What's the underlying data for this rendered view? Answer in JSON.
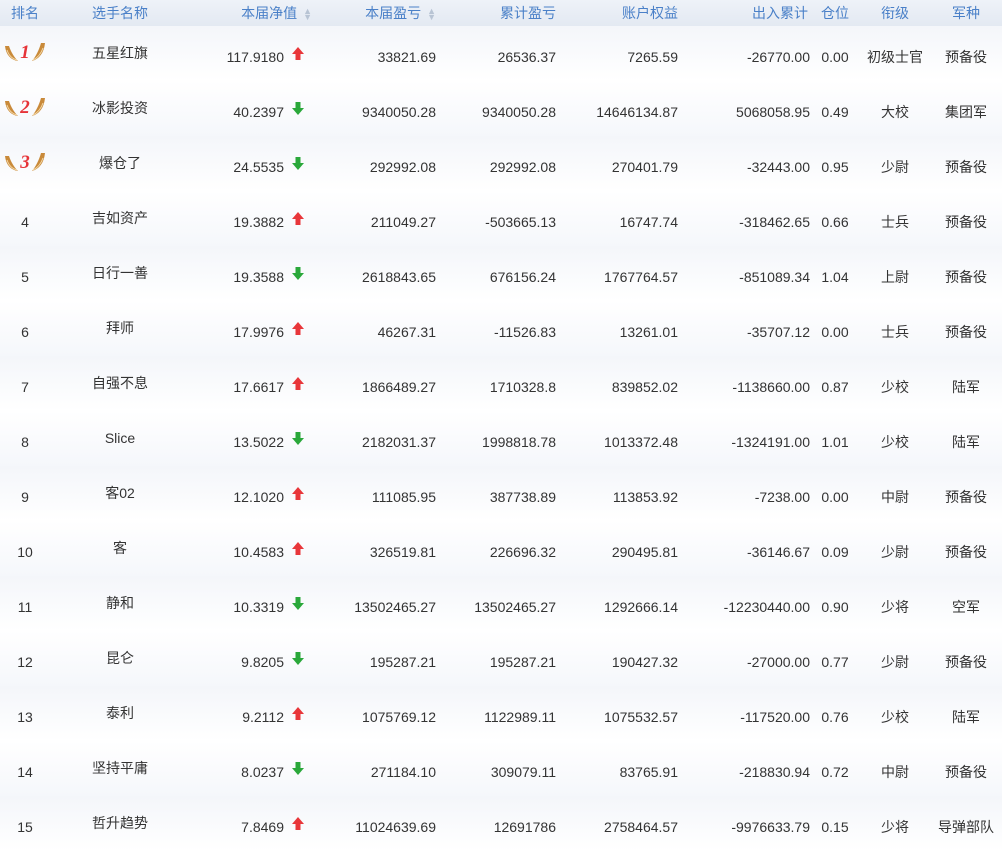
{
  "headers": [
    "排名",
    "选手名称",
    "本届净值",
    "本届盈亏",
    "累计盈亏",
    "账户权益",
    "出入累计",
    "仓位",
    "衔级",
    "军种"
  ],
  "colors": {
    "header_text": "#4a80c8",
    "up_arrow": "#e8363a",
    "down_arrow": "#2aa83a",
    "medal": "#c98a3a",
    "medal_number": "#e63338"
  },
  "rows": [
    {
      "rank": "1",
      "medal": true,
      "name": "五星红旗",
      "nav": "117.9180",
      "trend": "up",
      "period_pnl": "33821.69",
      "total_pnl": "26536.37",
      "equity": "7265.59",
      "flow": "-26770.00",
      "position": "0.00",
      "title": "初级士官",
      "branch": "预备役"
    },
    {
      "rank": "2",
      "medal": true,
      "name": "冰影投资",
      "nav": "40.2397",
      "trend": "down",
      "period_pnl": "9340050.28",
      "total_pnl": "9340050.28",
      "equity": "14646134.87",
      "flow": "5068058.95",
      "position": "0.49",
      "title": "大校",
      "branch": "集团军"
    },
    {
      "rank": "3",
      "medal": true,
      "name": "爆仓了",
      "nav": "24.5535",
      "trend": "down",
      "period_pnl": "292992.08",
      "total_pnl": "292992.08",
      "equity": "270401.79",
      "flow": "-32443.00",
      "position": "0.95",
      "title": "少尉",
      "branch": "预备役"
    },
    {
      "rank": "4",
      "medal": false,
      "name": "吉如资产",
      "nav": "19.3882",
      "trend": "up",
      "period_pnl": "211049.27",
      "total_pnl": "-503665.13",
      "equity": "16747.74",
      "flow": "-318462.65",
      "position": "0.66",
      "title": "士兵",
      "branch": "预备役"
    },
    {
      "rank": "5",
      "medal": false,
      "name": "日行一善",
      "nav": "19.3588",
      "trend": "down",
      "period_pnl": "2618843.65",
      "total_pnl": "676156.24",
      "equity": "1767764.57",
      "flow": "-851089.34",
      "position": "1.04",
      "title": "上尉",
      "branch": "预备役"
    },
    {
      "rank": "6",
      "medal": false,
      "name": "拜师",
      "nav": "17.9976",
      "trend": "up",
      "period_pnl": "46267.31",
      "total_pnl": "-11526.83",
      "equity": "13261.01",
      "flow": "-35707.12",
      "position": "0.00",
      "title": "士兵",
      "branch": "预备役"
    },
    {
      "rank": "7",
      "medal": false,
      "name": "自强不息",
      "nav": "17.6617",
      "trend": "up",
      "period_pnl": "1866489.27",
      "total_pnl": "1710328.8",
      "equity": "839852.02",
      "flow": "-1138660.00",
      "position": "0.87",
      "title": "少校",
      "branch": "陆军"
    },
    {
      "rank": "8",
      "medal": false,
      "name": "Slice",
      "nav": "13.5022",
      "trend": "down",
      "period_pnl": "2182031.37",
      "total_pnl": "1998818.78",
      "equity": "1013372.48",
      "flow": "-1324191.00",
      "position": "1.01",
      "title": "少校",
      "branch": "陆军"
    },
    {
      "rank": "9",
      "medal": false,
      "name": "客02",
      "nav": "12.1020",
      "trend": "up",
      "period_pnl": "111085.95",
      "total_pnl": "387738.89",
      "equity": "113853.92",
      "flow": "-7238.00",
      "position": "0.00",
      "title": "中尉",
      "branch": "预备役"
    },
    {
      "rank": "10",
      "medal": false,
      "name": "客",
      "nav": "10.4583",
      "trend": "up",
      "period_pnl": "326519.81",
      "total_pnl": "226696.32",
      "equity": "290495.81",
      "flow": "-36146.67",
      "position": "0.09",
      "title": "少尉",
      "branch": "预备役"
    },
    {
      "rank": "11",
      "medal": false,
      "name": "静和",
      "nav": "10.3319",
      "trend": "down",
      "period_pnl": "13502465.27",
      "total_pnl": "13502465.27",
      "equity": "1292666.14",
      "flow": "-12230440.00",
      "position": "0.90",
      "title": "少将",
      "branch": "空军"
    },
    {
      "rank": "12",
      "medal": false,
      "name": "昆仑",
      "nav": "9.8205",
      "trend": "down",
      "period_pnl": "195287.21",
      "total_pnl": "195287.21",
      "equity": "190427.32",
      "flow": "-27000.00",
      "position": "0.77",
      "title": "少尉",
      "branch": "预备役"
    },
    {
      "rank": "13",
      "medal": false,
      "name": "泰利",
      "nav": "9.2112",
      "trend": "up",
      "period_pnl": "1075769.12",
      "total_pnl": "1122989.11",
      "equity": "1075532.57",
      "flow": "-117520.00",
      "position": "0.76",
      "title": "少校",
      "branch": "陆军"
    },
    {
      "rank": "14",
      "medal": false,
      "name": "坚持平庸",
      "nav": "8.0237",
      "trend": "down",
      "period_pnl": "271184.10",
      "total_pnl": "309079.11",
      "equity": "83765.91",
      "flow": "-218830.94",
      "position": "0.72",
      "title": "中尉",
      "branch": "预备役"
    },
    {
      "rank": "15",
      "medal": false,
      "name": "哲升趋势",
      "nav": "7.8469",
      "trend": "up",
      "period_pnl": "11024639.69",
      "total_pnl": "12691786",
      "equity": "2758464.57",
      "flow": "-9976633.79",
      "position": "0.15",
      "title": "少将",
      "branch": "导弹部队"
    }
  ]
}
